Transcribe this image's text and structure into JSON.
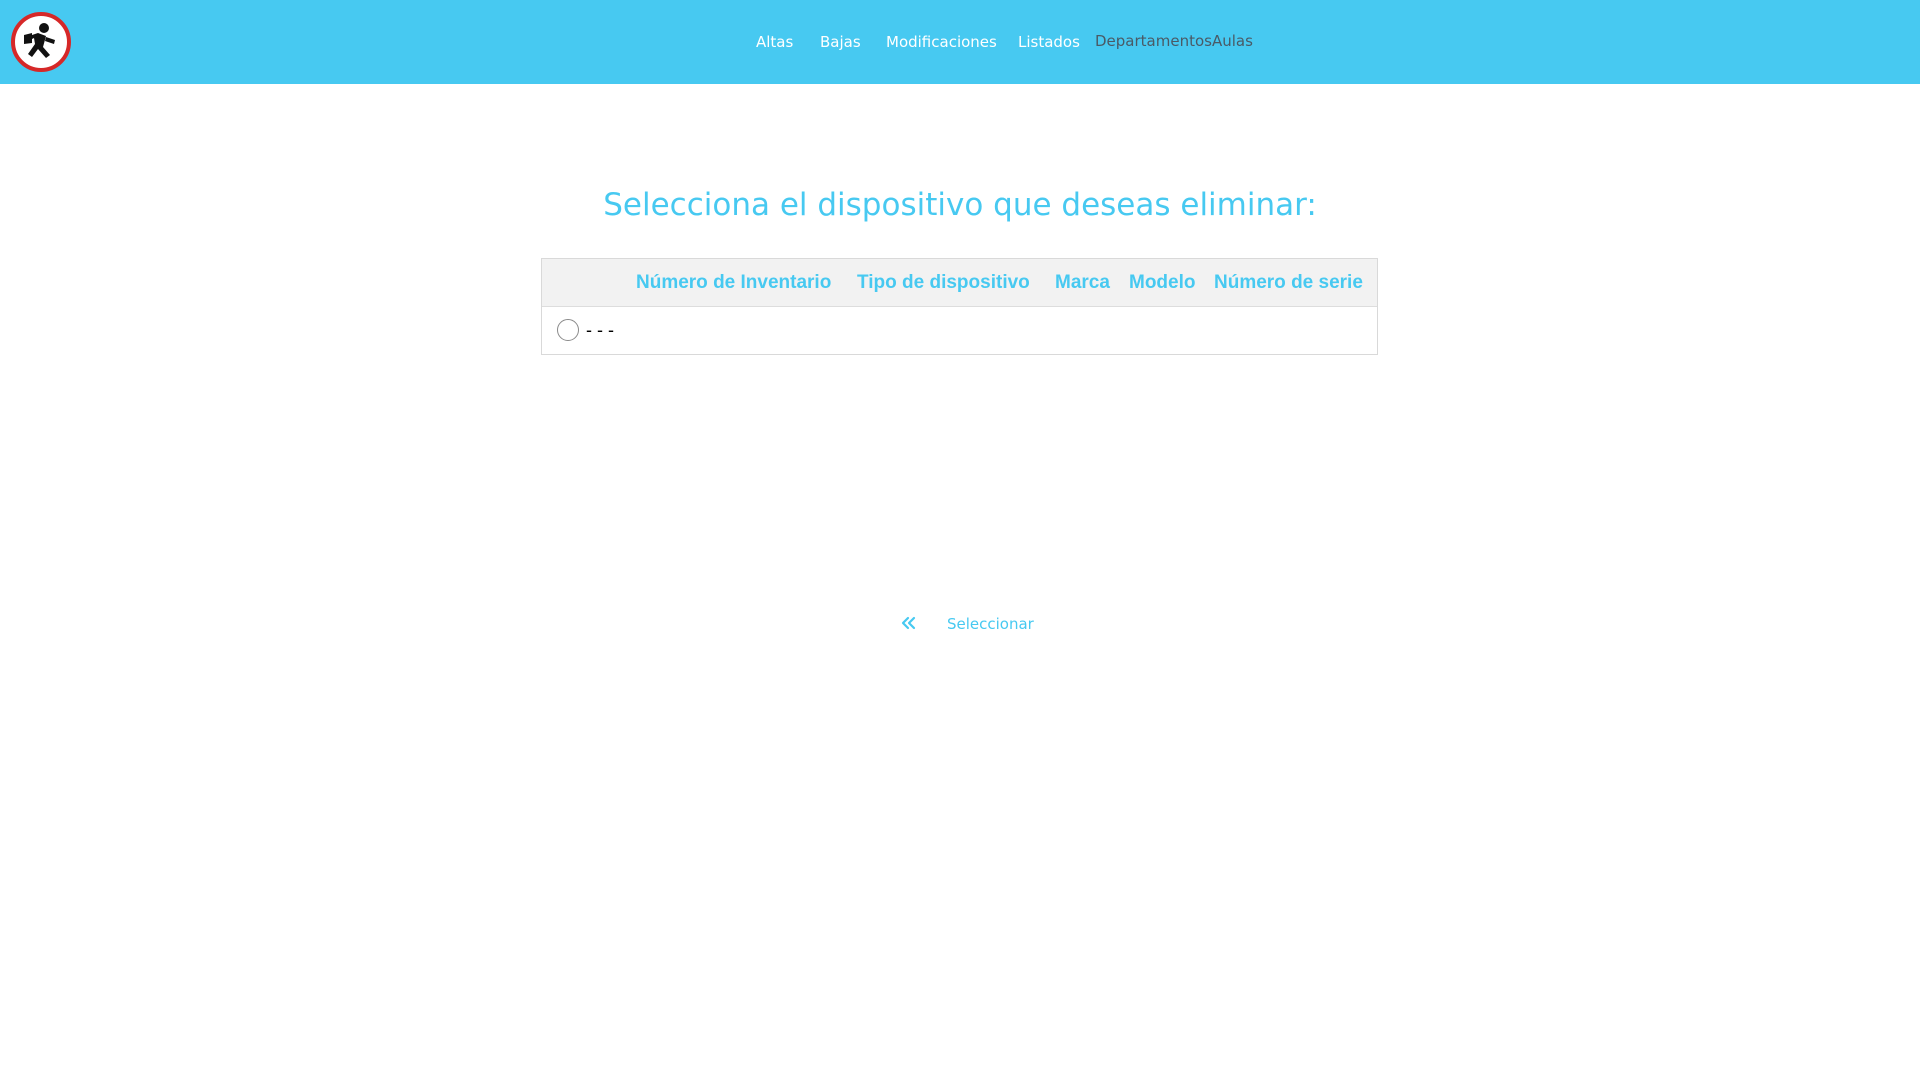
{
  "nav": {
    "logo_icon": "running-man-icon",
    "items": [
      {
        "label": "Altas"
      },
      {
        "label": "Bajas"
      },
      {
        "label": "Modificaciones"
      },
      {
        "label": "Listados"
      },
      {
        "label": "Departamentos"
      },
      {
        "label": "Aulas"
      }
    ]
  },
  "main": {
    "heading": "Selecciona el dispositivo que deseas eliminar:",
    "table": {
      "columns": [
        "Número de Inventario",
        "Tipo de dispositivo",
        "Marca",
        "Modelo",
        "Número de serie"
      ],
      "rows": [
        {
          "text": "- - -",
          "selected": false
        }
      ]
    },
    "actions": {
      "back_icon": "double-chevron-left-icon",
      "select_label": "Seleccionar"
    }
  },
  "colors": {
    "accent": "#47c9f1",
    "nav_dark_text": "#4a5a66",
    "header_bg": "#f2f2f2"
  }
}
